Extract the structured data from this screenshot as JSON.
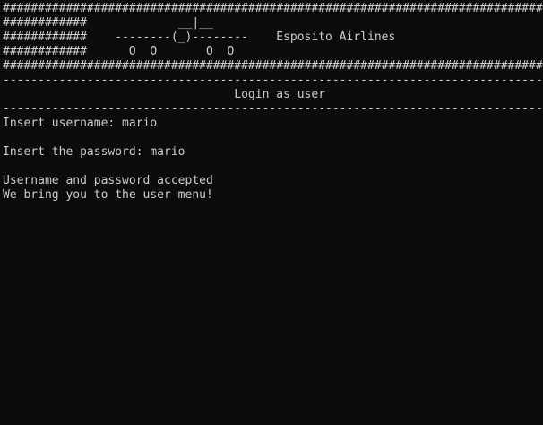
{
  "console": {
    "header_lines": [
      "###############################################################################################",
      "############             __|__                                                    ############",
      "############    --------(_)--------    Esposito Airlines                          ############",
      "############      O  O       O  O                                                 ############",
      "###############################################################################################"
    ],
    "divider_top": "-----------------------------------------------------------------------------------------------",
    "section_title": "                                 Login as user",
    "divider_bottom": "-----------------------------------------------------------------------------------------------",
    "username_prompt": "Insert username: mario",
    "password_prompt": "Insert the password: mario",
    "accepted_message": "Username and password accepted",
    "redirect_message": "We bring you to the user menu!"
  }
}
